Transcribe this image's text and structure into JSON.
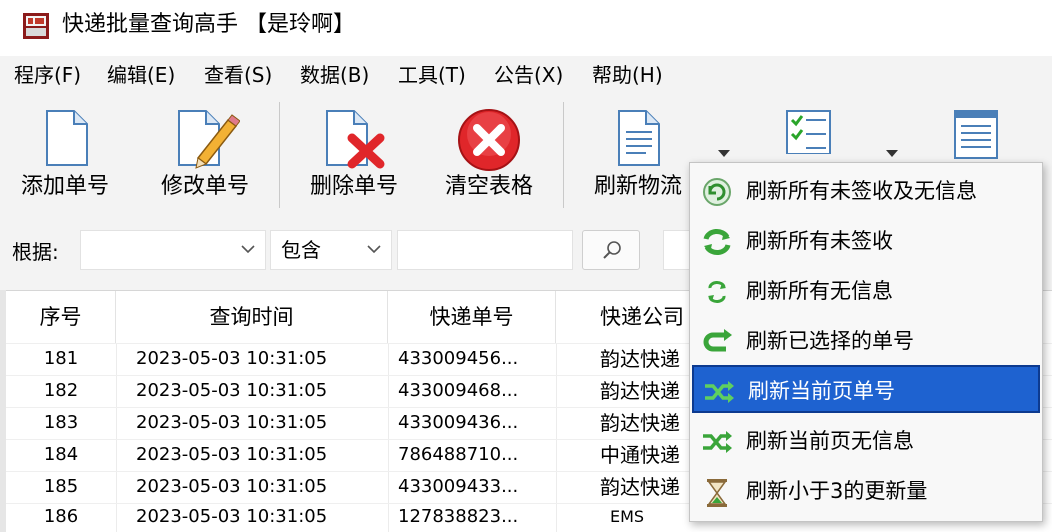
{
  "window": {
    "title": "快递批量查询高手 【是玲啊】",
    "icon": "app-logo-icon"
  },
  "menu": [
    {
      "label": "程序(F)"
    },
    {
      "label": "编辑(E)"
    },
    {
      "label": "查看(S)"
    },
    {
      "label": "数据(B)"
    },
    {
      "label": "工具(T)"
    },
    {
      "label": "公告(X)"
    },
    {
      "label": "帮助(H)"
    }
  ],
  "toolbar": {
    "add": "添加单号",
    "edit": "修改单号",
    "delete": "删除单号",
    "clear": "清空表格",
    "refresh": "刷新物流"
  },
  "filter": {
    "label": "根据:",
    "field_value": "",
    "match_value": "包含",
    "keyword_value": ""
  },
  "table": {
    "columns": [
      "序号",
      "查询时间",
      "快递单号",
      "快递公司"
    ],
    "rows": [
      {
        "no": "181",
        "time": "2023-05-03 10:31:05",
        "tracking": "433009456...",
        "company": "韵达快递"
      },
      {
        "no": "182",
        "time": "2023-05-03 10:31:05",
        "tracking": "433009468...",
        "company": "韵达快递"
      },
      {
        "no": "183",
        "time": "2023-05-03 10:31:05",
        "tracking": "433009436...",
        "company": "韵达快递"
      },
      {
        "no": "184",
        "time": "2023-05-03 10:31:05",
        "tracking": "786488710...",
        "company": "中通快递"
      },
      {
        "no": "185",
        "time": "2023-05-03 10:31:05",
        "tracking": "433009433...",
        "company": "韵达快递"
      },
      {
        "no": "186",
        "time": "2023-05-03 10:31:05",
        "tracking": "127838823...",
        "company": "EMS"
      }
    ]
  },
  "refresh_menu": {
    "items": [
      {
        "label": "刷新所有未签收及无信息",
        "icon": "refresh-circle-icon"
      },
      {
        "label": "刷新所有未签收",
        "icon": "refresh-green-arrows-icon"
      },
      {
        "label": "刷新所有无信息",
        "icon": "refresh-small-arrows-icon"
      },
      {
        "label": "刷新已选择的单号",
        "icon": "refresh-curve-arrow-icon"
      },
      {
        "label": "刷新当前页单号",
        "icon": "refresh-shuffle-icon"
      },
      {
        "label": "刷新当前页无信息",
        "icon": "refresh-cross-arrows-icon"
      },
      {
        "label": "刷新小于3的更新量",
        "icon": "hourglass-icon"
      }
    ],
    "selected_index": 4
  },
  "colors": {
    "selection": "#1e62d0",
    "accent_green": "#3aa53a",
    "delete_red": "#e0262a"
  }
}
